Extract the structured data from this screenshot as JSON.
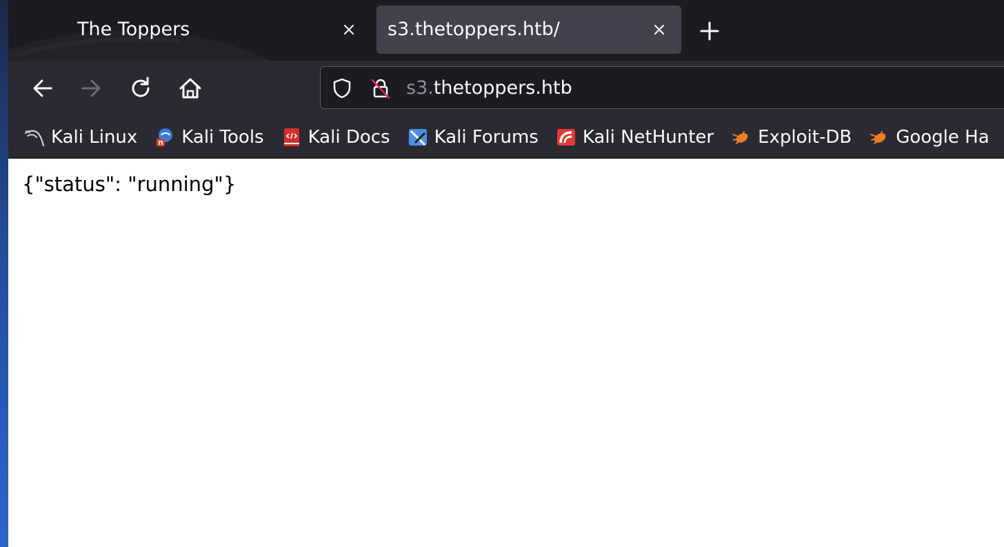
{
  "tabs": [
    {
      "title": "The Toppers",
      "active": false
    },
    {
      "title": "s3.thetoppers.htb/",
      "active": true
    }
  ],
  "urlbar": {
    "prefix": "s3.",
    "domain": "thetoppers.htb"
  },
  "bookmarks": [
    {
      "label": "Kali Linux",
      "icon": "kali-dragon-icon"
    },
    {
      "label": "Kali Tools",
      "icon": "kali-tools-icon"
    },
    {
      "label": "Kali Docs",
      "icon": "kali-docs-icon"
    },
    {
      "label": "Kali Forums",
      "icon": "kali-forums-icon"
    },
    {
      "label": "Kali NetHunter",
      "icon": "kali-nethunter-icon"
    },
    {
      "label": "Exploit-DB",
      "icon": "exploit-db-icon"
    },
    {
      "label": "Google Ha",
      "icon": "exploit-db-icon"
    }
  ],
  "page": {
    "body_text": "{\"status\": \"running\"}"
  },
  "colors": {
    "tabstrip": "#1c1b22",
    "toolbar": "#2b2a33",
    "active_tab": "#42414d",
    "text": "#fbfbfe",
    "url_prefix": "#8f8f9d",
    "desktop": "#2c66c9"
  }
}
